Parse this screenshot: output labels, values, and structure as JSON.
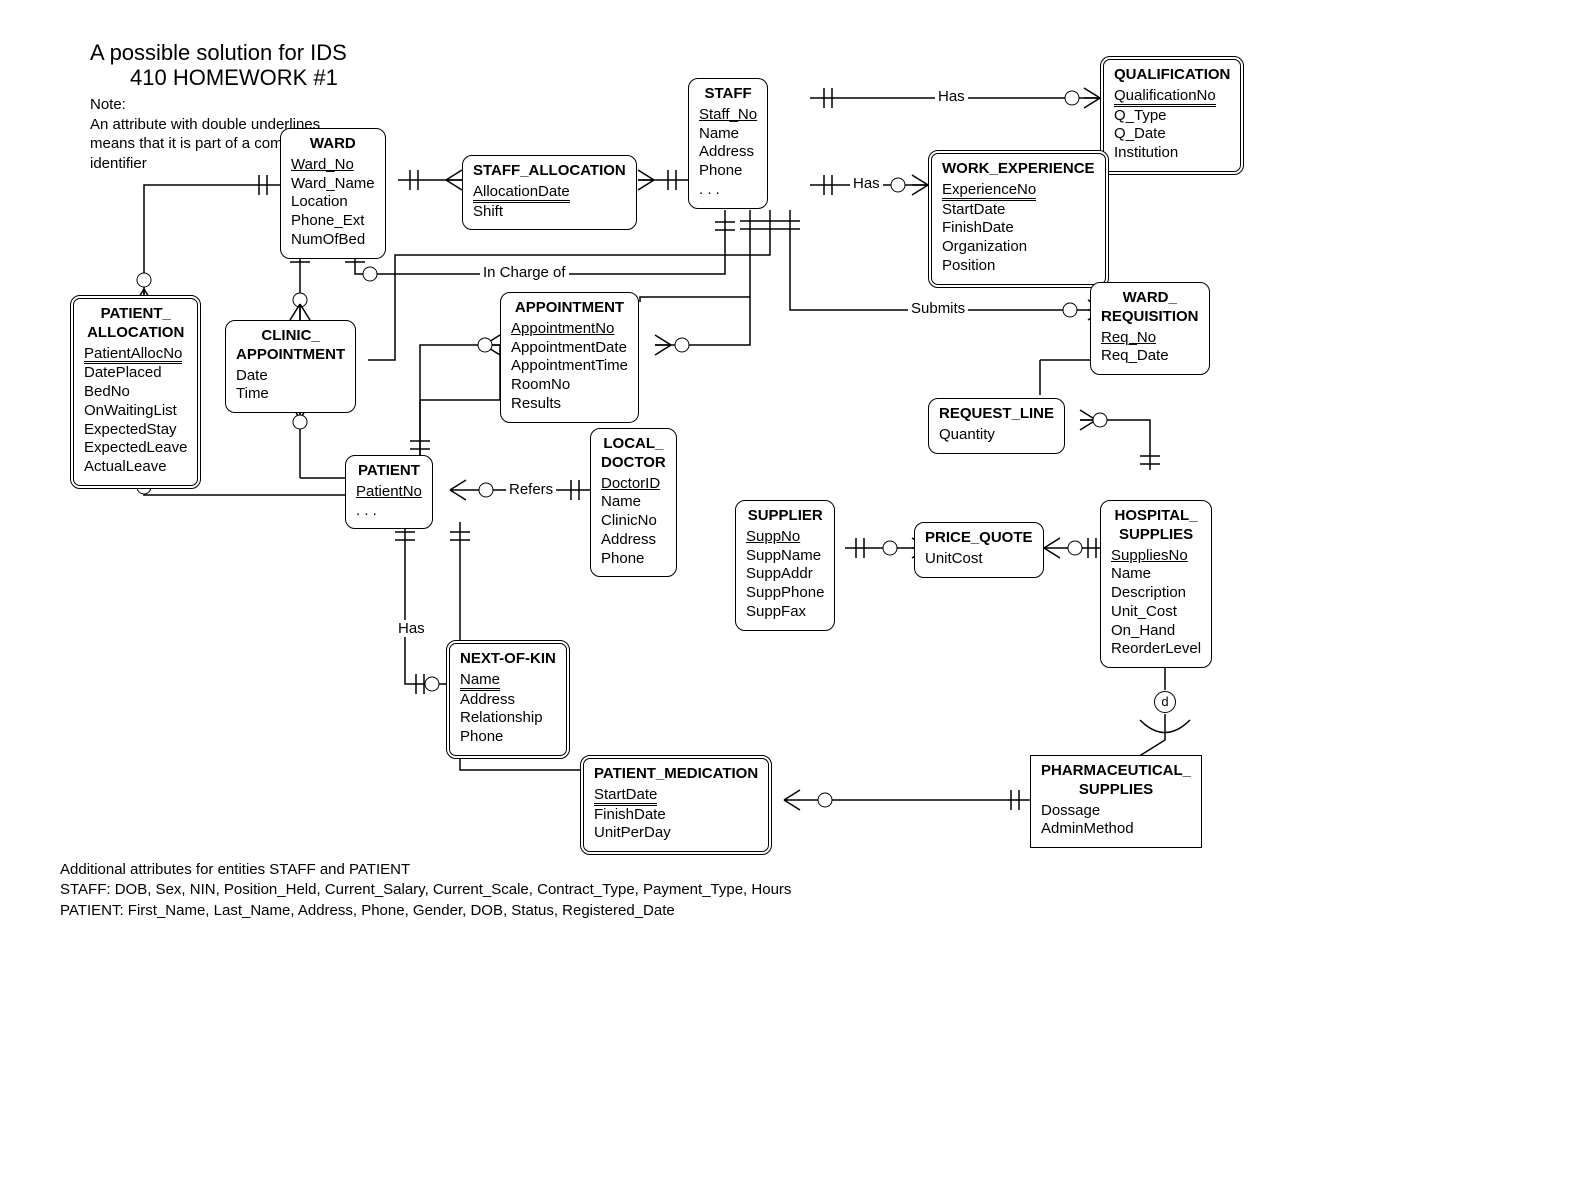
{
  "title1": "A possible solution for IDS",
  "title2": "410 HOMEWORK #1",
  "noteHeading": "Note:",
  "noteText": "An attribute with double underlines  means that it is part of a composite identifier",
  "entities": {
    "ward": {
      "name": "WARD",
      "attrs": [
        "Ward_No",
        "Ward_Name",
        "Location",
        "Phone_Ext",
        "NumOfBed"
      ],
      "pk": 0
    },
    "staff_allocation": {
      "name": "STAFF_ALLOCATION",
      "attrs": [
        "AllocationDate",
        "Shift"
      ],
      "ppk": 0
    },
    "staff": {
      "name": "STAFF",
      "attrs": [
        "Staff_No",
        "Name",
        "Address",
        "Phone",
        ". . ."
      ],
      "pk": 0
    },
    "qualification": {
      "name": "QUALIFICATION",
      "attrs": [
        "QualificationNo",
        "Q_Type",
        "Q_Date",
        "Institution"
      ],
      "ppk": 0
    },
    "work_experience": {
      "name": "WORK_EXPERIENCE",
      "attrs": [
        "ExperienceNo",
        "StartDate",
        "FinishDate",
        "Organization",
        "Position"
      ],
      "ppk": 0
    },
    "patient_allocation": {
      "name": "PATIENT_\nALLOCATION",
      "attrs": [
        "PatientAllocNo",
        "DatePlaced",
        "BedNo",
        "OnWaitingList",
        "ExpectedStay",
        "ExpectedLeave",
        "ActualLeave"
      ],
      "ppk": 0
    },
    "clinic_appointment": {
      "name": "CLINIC_\nAPPOINTMENT",
      "attrs": [
        "Date",
        "Time"
      ]
    },
    "appointment": {
      "name": "APPOINTMENT",
      "attrs": [
        "AppointmentNo",
        "AppointmentDate",
        "AppointmentTime",
        "RoomNo",
        "Results"
      ],
      "pk": 0
    },
    "ward_requisition": {
      "name": "WARD_\nREQUISITION",
      "attrs": [
        "Req_No",
        "Req_Date"
      ],
      "pk": 0
    },
    "request_line": {
      "name": "REQUEST_LINE",
      "attrs": [
        "Quantity"
      ]
    },
    "patient": {
      "name": "PATIENT",
      "attrs": [
        "PatientNo",
        ". . ."
      ],
      "pk": 0
    },
    "local_doctor": {
      "name": "LOCAL_\nDOCTOR",
      "attrs": [
        "DoctorID",
        "Name",
        "ClinicNo",
        "Address",
        "Phone"
      ],
      "pk": 0
    },
    "supplier": {
      "name": "SUPPLIER",
      "attrs": [
        "SuppNo",
        "SuppName",
        "SuppAddr",
        "SuppPhone",
        "SuppFax"
      ],
      "pk": 0
    },
    "price_quote": {
      "name": "PRICE_QUOTE",
      "attrs": [
        "UnitCost"
      ]
    },
    "hospital_supplies": {
      "name": "HOSPITAL_\nSUPPLIES",
      "attrs": [
        "SuppliesNo",
        "Name",
        "Description",
        "Unit_Cost",
        "On_Hand",
        "ReorderLevel"
      ],
      "pk": 0
    },
    "next_of_kin": {
      "name": "NEXT-OF-KIN",
      "attrs": [
        "Name",
        "Address",
        "Relationship",
        "Phone"
      ],
      "ppk": 0
    },
    "patient_medication": {
      "name": "PATIENT_MEDICATION",
      "attrs": [
        "StartDate",
        "FinishDate",
        "UnitPerDay"
      ],
      "ppk": 0
    },
    "pharmaceutical_supplies": {
      "name": "PHARMACEUTICAL_\nSUPPLIES",
      "attrs": [
        "Dossage",
        "AdminMethod"
      ]
    }
  },
  "labels": {
    "has1": "Has",
    "has2": "Has",
    "has3": "Has",
    "incharge": "In Charge of",
    "refers": "Refers",
    "submits": "Submits",
    "d": "d"
  },
  "footer": {
    "l1": "Additional attributes for entities STAFF and PATIENT",
    "l2": "STAFF: DOB, Sex, NIN, Position_Held, Current_Salary, Current_Scale, Contract_Type, Payment_Type, Hours",
    "l3": "PATIENT: First_Name, Last_Name, Address, Phone, Gender, DOB, Status, Registered_Date"
  }
}
